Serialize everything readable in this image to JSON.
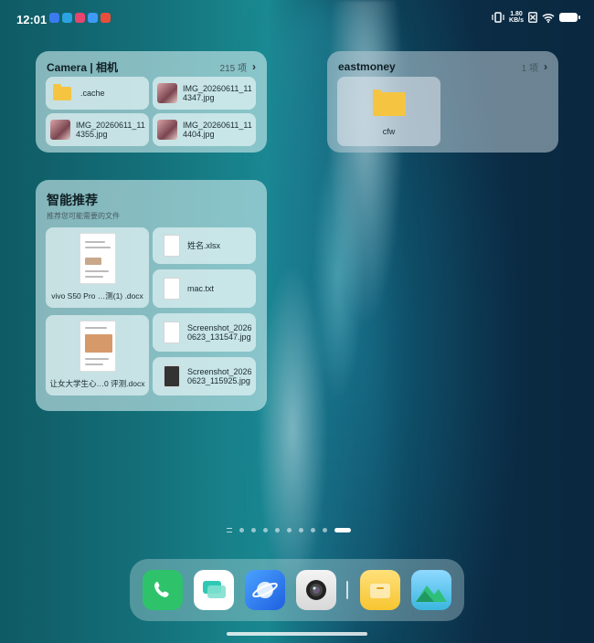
{
  "status_bar": {
    "time": "12:01",
    "net_speed_value": "1.80",
    "net_speed_unit": "KB/s"
  },
  "camera_widget": {
    "title": "Camera | 相机",
    "count": "215 项",
    "items": [
      {
        "name": ".cache",
        "type": "folder"
      },
      {
        "name": "IMG_20260611_114347.jpg",
        "type": "image"
      },
      {
        "name": "IMG_20260611_114355.jpg",
        "type": "image"
      },
      {
        "name": "IMG_20260611_114404.jpg",
        "type": "image"
      }
    ]
  },
  "eastmoney_widget": {
    "title": "eastmoney",
    "count": "1 项",
    "items": [
      {
        "name": "cfw",
        "type": "folder"
      }
    ]
  },
  "recommend_widget": {
    "title": "智能推荐",
    "subtitle": "推荐您可能需要的文件",
    "large_items": [
      {
        "name": "vivo S50 Pro …测(1) .docx"
      },
      {
        "name": "让女大学生心…0 评测.docx"
      }
    ],
    "small_items": [
      {
        "name": "姓名.xlsx"
      },
      {
        "name": "mac.txt"
      },
      {
        "name": "Screenshot_20260623_131547.jpg"
      },
      {
        "name": "Screenshot_20260623_115925.jpg"
      }
    ]
  },
  "page_indicator": {
    "pages": 10,
    "current": 10
  },
  "dock": {
    "apps": [
      "phone-app",
      "messages-app",
      "browser-app",
      "camera-app",
      "file-manager-app",
      "gallery-app"
    ]
  },
  "colors": {
    "phone": "#2ec36a",
    "messages": "#2fc8b4",
    "browser": "#1f6fe8",
    "folder": "#f5c542"
  }
}
